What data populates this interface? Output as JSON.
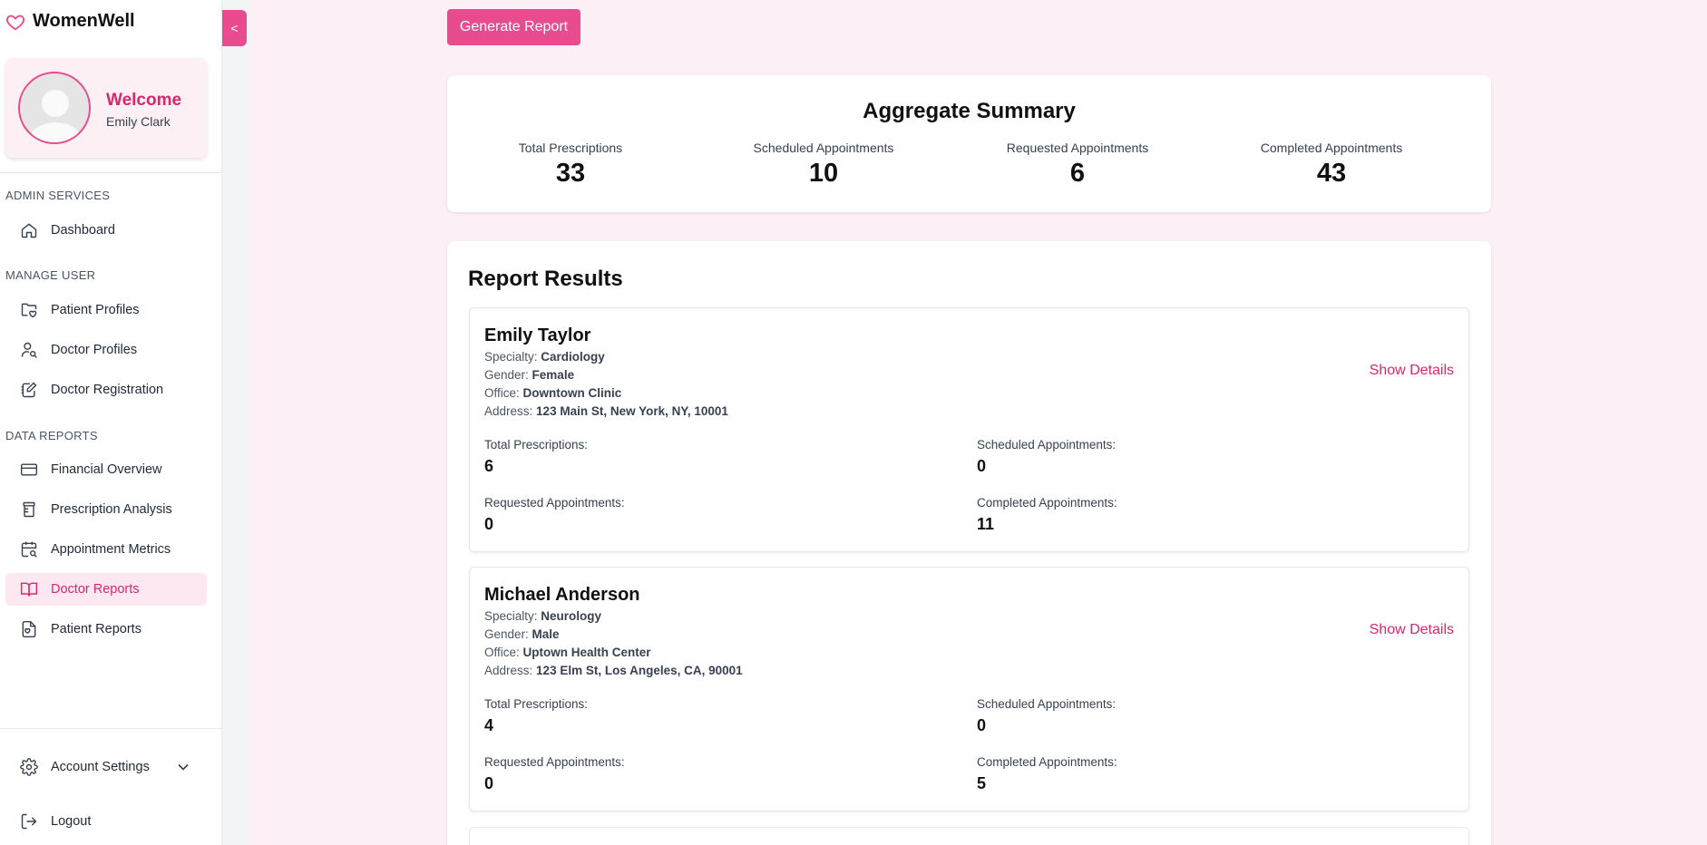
{
  "app": {
    "name": "WomenWell",
    "collapse_label": "<"
  },
  "profile": {
    "welcome": "Welcome",
    "name": "Emily Clark"
  },
  "nav": {
    "sections": [
      "ADMIN SERVICES",
      "MANAGE USER",
      "DATA REPORTS"
    ],
    "items": [
      {
        "label": "Dashboard",
        "icon": "home-icon"
      },
      {
        "label": "Patient Profiles",
        "icon": "folder-heart-icon"
      },
      {
        "label": "Doctor Profiles",
        "icon": "user-search-icon"
      },
      {
        "label": "Doctor Registration",
        "icon": "edit-notebook-icon"
      },
      {
        "label": "Financial Overview",
        "icon": "credit-card-icon"
      },
      {
        "label": "Prescription Analysis",
        "icon": "pill-bottle-icon"
      },
      {
        "label": "Appointment Metrics",
        "icon": "calendar-search-icon"
      },
      {
        "label": "Doctor Reports",
        "icon": "book-open-icon",
        "active": true
      },
      {
        "label": "Patient Reports",
        "icon": "file-heart-icon"
      }
    ],
    "account_settings": "Account Settings",
    "logout": "Logout"
  },
  "toolbar": {
    "generate_label": "Generate Report"
  },
  "summary": {
    "title": "Aggregate Summary",
    "stats": [
      {
        "label": "Total Prescriptions",
        "value": "33"
      },
      {
        "label": "Scheduled Appointments",
        "value": "10"
      },
      {
        "label": "Requested Appointments",
        "value": "6"
      },
      {
        "label": "Completed Appointments",
        "value": "43"
      }
    ]
  },
  "results": {
    "title": "Report Results",
    "field_labels": {
      "specialty": "Specialty:",
      "gender": "Gender:",
      "office": "Office:",
      "address": "Address:"
    },
    "metric_labels": {
      "total": "Total Prescriptions:",
      "scheduled": "Scheduled Appointments:",
      "requested": "Requested Appointments:",
      "completed": "Completed Appointments:"
    },
    "show_details_label": "Show Details",
    "doctors": [
      {
        "name": "Emily Taylor",
        "specialty": "Cardiology",
        "gender": "Female",
        "office": "Downtown Clinic",
        "address": "123 Main St, New York, NY, 10001",
        "total": "6",
        "scheduled": "0",
        "requested": "0",
        "completed": "11"
      },
      {
        "name": "Michael Anderson",
        "specialty": "Neurology",
        "gender": "Male",
        "office": "Uptown Health Center",
        "address": "123 Elm St, Los Angeles, CA, 90001",
        "total": "4",
        "scheduled": "0",
        "requested": "0",
        "completed": "5"
      }
    ]
  },
  "colors": {
    "accent": "#e94b8f",
    "accent_text": "#d6286f",
    "background": "#fcf0f6",
    "active_bg": "#fde7f1"
  }
}
